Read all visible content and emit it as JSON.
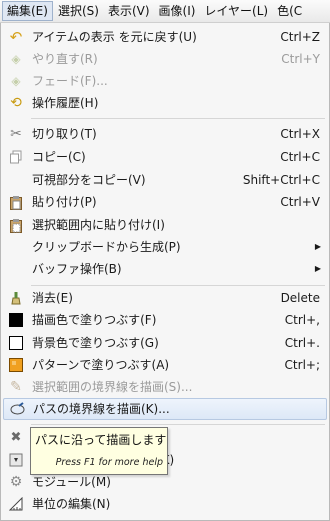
{
  "menubar": {
    "items": [
      "編集(E)",
      "選択(S)",
      "表示(V)",
      "画像(I)",
      "レイヤー(L)",
      "色(C"
    ]
  },
  "menu": {
    "items": [
      {
        "label": "アイテムの表示 を元に戻す(U)",
        "shortcut": "Ctrl+Z",
        "icon": "undo-icon"
      },
      {
        "label": "やり直す(R)",
        "shortcut": "Ctrl+Y",
        "icon": "redo-icon"
      },
      {
        "label": "フェード(F)...",
        "shortcut": "",
        "icon": "fade-icon"
      },
      {
        "label": "操作履歴(H)",
        "shortcut": "",
        "icon": "history-icon"
      },
      {
        "label": "切り取り(T)",
        "shortcut": "Ctrl+X",
        "icon": "cut-icon"
      },
      {
        "label": "コピー(C)",
        "shortcut": "Ctrl+C",
        "icon": "copy-icon"
      },
      {
        "label": "可視部分をコピー(V)",
        "shortcut": "Shift+Ctrl+C",
        "icon": ""
      },
      {
        "label": "貼り付け(P)",
        "shortcut": "Ctrl+V",
        "icon": "paste-icon"
      },
      {
        "label": "選択範囲内に貼り付け(I)",
        "shortcut": "",
        "icon": "paste-into-icon"
      },
      {
        "label": "クリップボードから生成(P)",
        "shortcut": "",
        "icon": ""
      },
      {
        "label": "バッファ操作(B)",
        "shortcut": "",
        "icon": ""
      },
      {
        "label": "消去(E)",
        "shortcut": "Delete",
        "icon": "clear-icon"
      },
      {
        "label": "描画色で塗りつぶす(F)",
        "shortcut": "Ctrl+,",
        "icon": "fg-fill-icon"
      },
      {
        "label": "背景色で塗りつぶす(G)",
        "shortcut": "Ctrl+.",
        "icon": "bg-fill-icon"
      },
      {
        "label": "パターンで塗りつぶす(A)",
        "shortcut": "Ctrl+;",
        "icon": "pattern-fill-icon"
      },
      {
        "label": "選択範囲の境界線を描画(S)...",
        "shortcut": "",
        "icon": "stroke-selection-icon"
      },
      {
        "label": "パスの境界線を描画(K)...",
        "shortcut": "",
        "icon": "stroke-path-icon"
      },
      {
        "label": "ト(K)",
        "shortcut": "",
        "icon": "preferences-icon"
      },
      {
        "label": "",
        "shortcut": "",
        "icon": "input-devices-icon"
      },
      {
        "label": "モジュール(M)",
        "shortcut": "",
        "icon": "modules-icon"
      },
      {
        "label": "単位の編集(N)",
        "shortcut": "",
        "icon": "units-icon"
      }
    ]
  },
  "tooltip": {
    "title": "パスに沿って描画します",
    "hint": "Press F1 for more help"
  }
}
